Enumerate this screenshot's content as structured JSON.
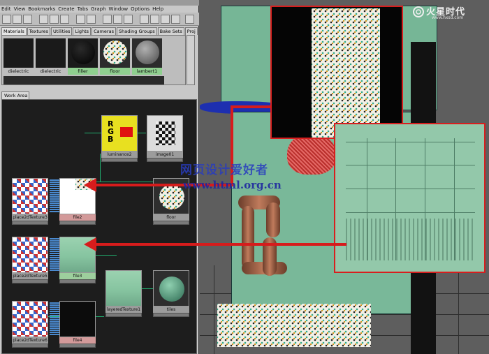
{
  "menubar": [
    "Edit",
    "View",
    "Bookmarks",
    "Create",
    "Tabs",
    "Graph",
    "Window",
    "Options",
    "Help"
  ],
  "tabs": [
    "Materials",
    "Textures",
    "Utilities",
    "Lights",
    "Cameras",
    "Shading Groups",
    "Bake Sets",
    "Proj"
  ],
  "swatches": [
    {
      "label": "dielectric"
    },
    {
      "label": "dielectric"
    },
    {
      "label": "filler"
    },
    {
      "label": "floor"
    },
    {
      "label": "lambert1"
    }
  ],
  "workarea_label": "Work Area",
  "nodes": {
    "rgb_node": "luminance2",
    "file_top": "image01",
    "place1": "place2dTexture3",
    "tile_tex": "file2",
    "floor_mat": "floor",
    "place2": "place2dTexture5",
    "green_tex": "file3",
    "layered": "layeredTexture1",
    "tiles_mat": "tiles",
    "place3": "place2dTexture6",
    "dark_tex": "file4"
  },
  "logo": {
    "text": "火星时代",
    "url": "www.hxsd.com"
  },
  "watermark": {
    "cn": "网页设计爱好者",
    "url": "www.html.org.cn"
  },
  "colors": {
    "accent_red": "#d81e1e",
    "wall_green": "#79b899",
    "workarea_bg": "#1d1d1d"
  }
}
